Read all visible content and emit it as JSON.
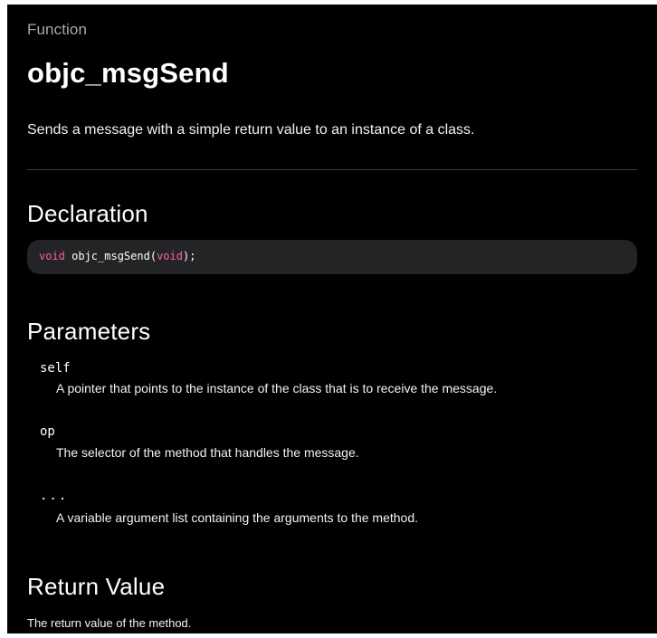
{
  "eyebrow": "Function",
  "title": "objc_msgSend",
  "abstract": "Sends a message with a simple return value to an instance of a class.",
  "declaration": {
    "heading": "Declaration",
    "return_type": "void",
    "name_open": " objc_msgSend(",
    "param_type": "void",
    "close": ");"
  },
  "parameters": {
    "heading": "Parameters",
    "items": [
      {
        "name": "self",
        "description": "A pointer that points to the instance of the class that is to receive the message."
      },
      {
        "name": "op",
        "description": "The selector of the method that handles the message."
      },
      {
        "name": "...",
        "description": "A variable argument list containing the arguments to the method."
      }
    ]
  },
  "return_value": {
    "heading": "Return Value",
    "text": "The return value of the method."
  },
  "colors": {
    "background": "#000000",
    "keyword": "#fc5fa3",
    "code_background": "#242426",
    "eyebrow": "#a8a8ad"
  }
}
